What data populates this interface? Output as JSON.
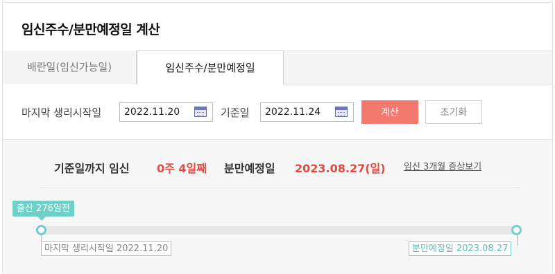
{
  "header": {
    "title": "임신주수/분만예정일 계산"
  },
  "tabs": [
    {
      "label": "배란일(임신가능일)",
      "active": false
    },
    {
      "label": "임신주수/분만예정일",
      "active": true
    }
  ],
  "form": {
    "last_period_label": "마지막 생리시작일",
    "last_period_value": "2022.11.20",
    "base_date_label": "기준일",
    "base_date_value": "2022.11.24",
    "calc_button": "계산",
    "reset_button": "초기화"
  },
  "result": {
    "prefix": "기준일까지 임신",
    "weeks_days": "0주 4일째",
    "due_label": "분만예정일",
    "due_value": "2023.08.27(일)",
    "symptoms_link": "임신 3개월 증상보기"
  },
  "timeline": {
    "badge": "출산 276일전",
    "progress": 0.0,
    "start_tag": "마지막 생리시작일 2022.11.20",
    "end_tag": "분만예정일 2023.08.27"
  },
  "colors": {
    "accent_red": "#e8473b",
    "calc_button_bg": "#f47a6f",
    "teal": "#6fd0c8"
  },
  "icons": {
    "calendar": "calendar-icon"
  }
}
